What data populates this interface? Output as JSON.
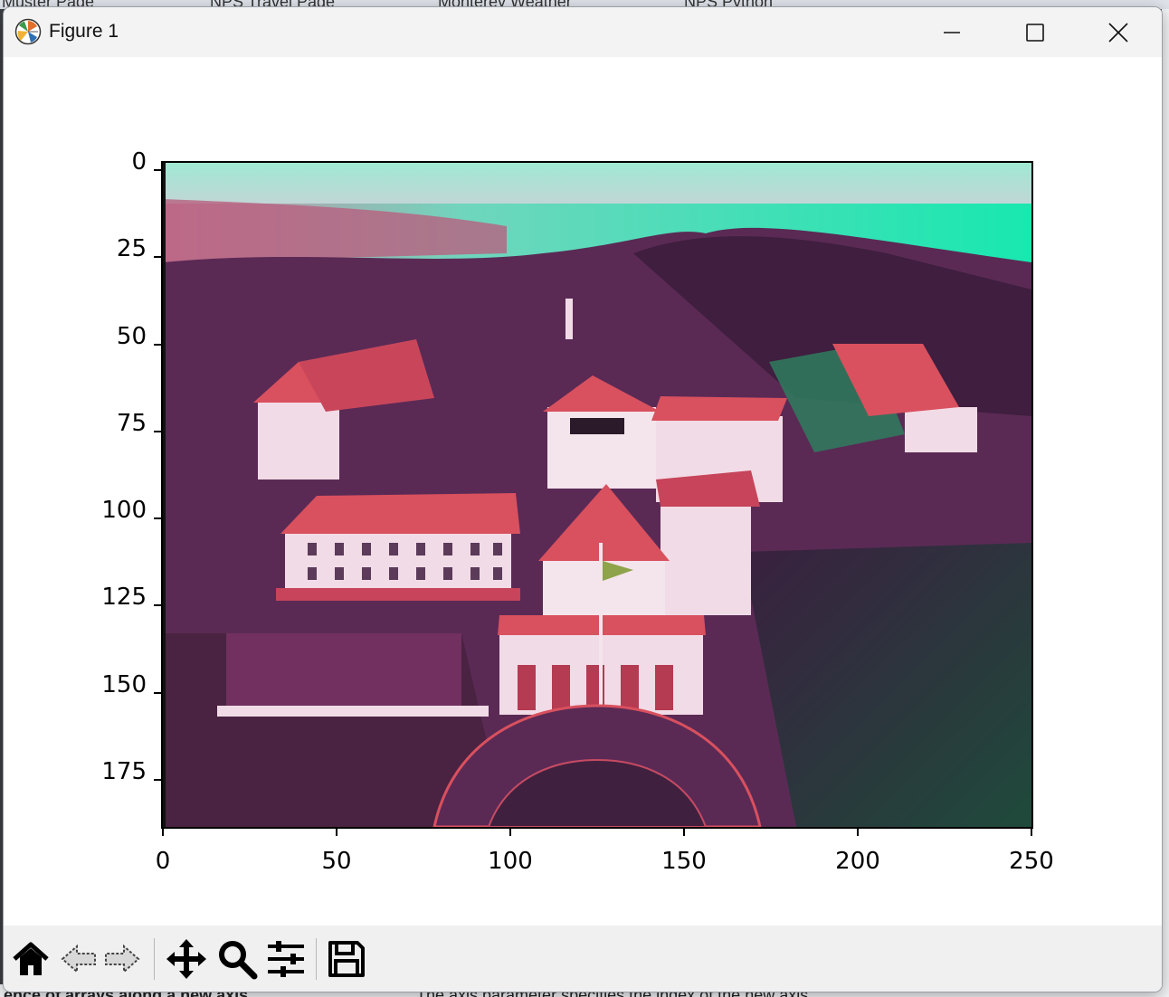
{
  "background": {
    "tabs": [
      "Muster Page",
      "NPS Travel Page",
      "Monterey Weather",
      "NPS Python"
    ],
    "bottom_text_left": "ence of arrays along a new axis",
    "bottom_text_right": "The axis parameter specifies the index of the new axis"
  },
  "window": {
    "title": "Figure 1",
    "icon": "matplotlib-icon",
    "controls": [
      "minimize-icon",
      "maximize-icon",
      "close-icon"
    ]
  },
  "figure": {
    "image_description_hidden": false,
    "y_ticks": [
      "0",
      "25",
      "50",
      "75",
      "100",
      "125",
      "150",
      "175"
    ],
    "x_ticks": [
      "0",
      "50",
      "100",
      "150",
      "200",
      "250"
    ],
    "y_tick_values": [
      0,
      25,
      50,
      75,
      100,
      125,
      150,
      175
    ],
    "x_tick_values": [
      0,
      50,
      100,
      150,
      200,
      250
    ],
    "x_range": [
      0,
      250
    ],
    "y_range": [
      0,
      192
    ],
    "y_inverted": true
  },
  "toolbar": {
    "items": [
      {
        "name": "home-icon",
        "interactable": true
      },
      {
        "name": "back-arrow-icon",
        "interactable": true
      },
      {
        "name": "forward-arrow-icon",
        "interactable": true
      },
      {
        "name": "pan-icon",
        "interactable": true
      },
      {
        "name": "zoom-icon",
        "interactable": true
      },
      {
        "name": "configure-subplots-icon",
        "interactable": true
      },
      {
        "name": "save-icon",
        "interactable": true
      }
    ]
  },
  "colors": {
    "sky": "#9fe8d2",
    "sea": "#27e8b3",
    "foliage": "#5a2a55",
    "roof": "#d9505e",
    "wall": "#f1dbe6",
    "lawn": "#2c5c49"
  }
}
